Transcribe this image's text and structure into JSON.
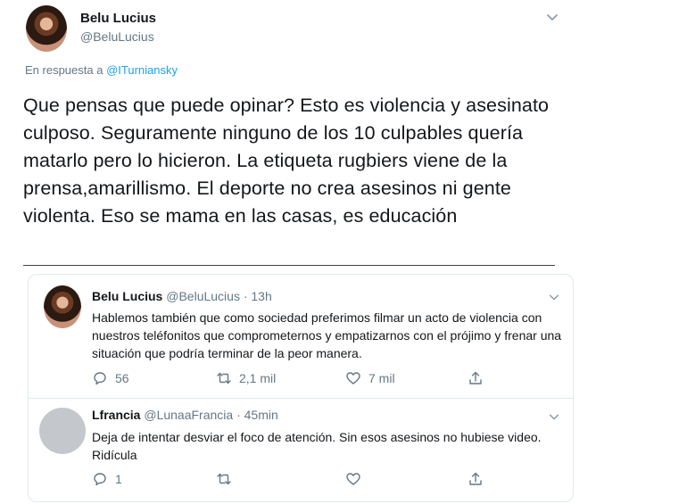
{
  "main_tweet": {
    "author_name": "Belu Lucius",
    "author_handle": "@BeluLucius",
    "reply_prefix": "En respuesta a",
    "reply_handle": "@ITurniansky",
    "text": "Que pensas que puede opinar? Esto es violencia y asesinato culposo. Seguramente ninguno de los 10 culpables quería matarlo pero lo hicieron. La etiqueta rugbiers viene de la prensa,amarillismo. El deporte no crea asesinos ni gente violenta. Eso se mama en las casas, es educación"
  },
  "thread": [
    {
      "author_name": "Belu Lucius",
      "handle_time": "@BeluLucius · 13h",
      "text": "Hablemos también que como sociedad preferimos filmar un acto de violencia con nuestros teléfonitos que comprometernos y empatizarnos con el prójimo y frenar una situación que podría terminar de la peor manera.",
      "replies": "56",
      "retweets": "2,1 mil",
      "likes": "7 mil"
    },
    {
      "author_name": "Lfrancia",
      "handle_time": "@LunaaFrancia · 45min",
      "text": "Deja de intentar desviar el foco de atención. Sin esos asesinos no hubiese video. Ridícula",
      "replies": "1",
      "retweets": "",
      "likes": ""
    }
  ],
  "icons": {
    "reply": "reply-icon",
    "retweet": "retweet-icon",
    "like": "heart-icon",
    "share": "share-icon",
    "more": "chevron-down-icon"
  },
  "colors": {
    "link": "#1da1f2",
    "secondary_text": "#657786",
    "border": "#e1e8ed"
  }
}
